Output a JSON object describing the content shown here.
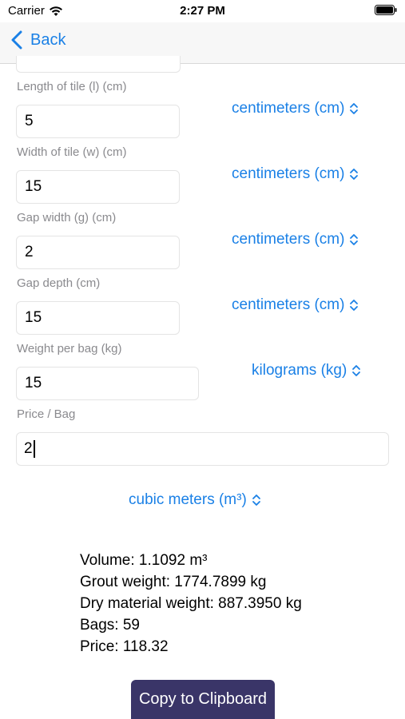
{
  "status_bar": {
    "carrier": "Carrier",
    "time": "2:27 PM"
  },
  "nav": {
    "back_label": "Back"
  },
  "fields": [
    {
      "label": "Length of tile (l) (cm)",
      "value": "5",
      "unit": "centimeters (cm)"
    },
    {
      "label": "Width of tile (w) (cm)",
      "value": "15",
      "unit": "centimeters (cm)"
    },
    {
      "label": "Gap width (g) (cm)",
      "value": "2",
      "unit": "centimeters (cm)"
    },
    {
      "label": "Gap depth (cm)",
      "value": "15",
      "unit": "centimeters (cm)"
    },
    {
      "label": "Weight per bag (kg)",
      "value": "15",
      "unit": "kilograms (kg)"
    },
    {
      "label": "Price / Bag",
      "value": "2"
    }
  ],
  "volume_unit": "cubic meters (m³)",
  "results": {
    "volume": "Volume: 1.1092 m³",
    "grout_weight": "Grout weight: 1774.7899 kg",
    "dry_weight": "Dry material weight: 887.3950 kg",
    "bags": "Bags: 59",
    "price": "Price: 118.32"
  },
  "copy_button_label": "Copy to Clipboard",
  "colors": {
    "accent": "#1a80e6",
    "button_bg": "#3a3568",
    "label_gray": "#8a8a8e"
  }
}
